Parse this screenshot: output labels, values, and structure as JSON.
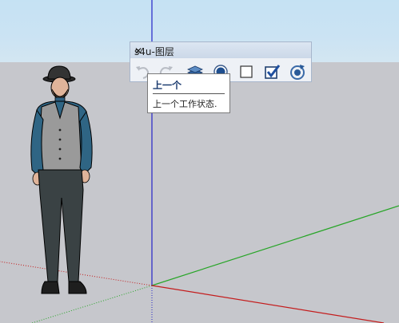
{
  "toolbar": {
    "title": "s4u-图层",
    "buttons": [
      {
        "name": "undo-layer-state-icon",
        "enabled": false
      },
      {
        "name": "redo-layer-state-icon",
        "enabled": false
      },
      {
        "name": "layers-stack-icon",
        "enabled": true
      },
      {
        "name": "radio-dot-icon",
        "enabled": true
      },
      {
        "name": "empty-checkbox-icon",
        "enabled": true
      },
      {
        "name": "checked-checkbox-icon",
        "enabled": true
      },
      {
        "name": "refresh-target-icon",
        "enabled": true
      }
    ]
  },
  "tooltip": {
    "title": "上一个",
    "description": "上一个工作状态."
  },
  "colors": {
    "sky": "#cbe3f3",
    "ground": "#c6c7cc",
    "axis_blue": "#2020d0",
    "axis_green": "#2aa82a",
    "axis_red": "#c81e1e"
  }
}
